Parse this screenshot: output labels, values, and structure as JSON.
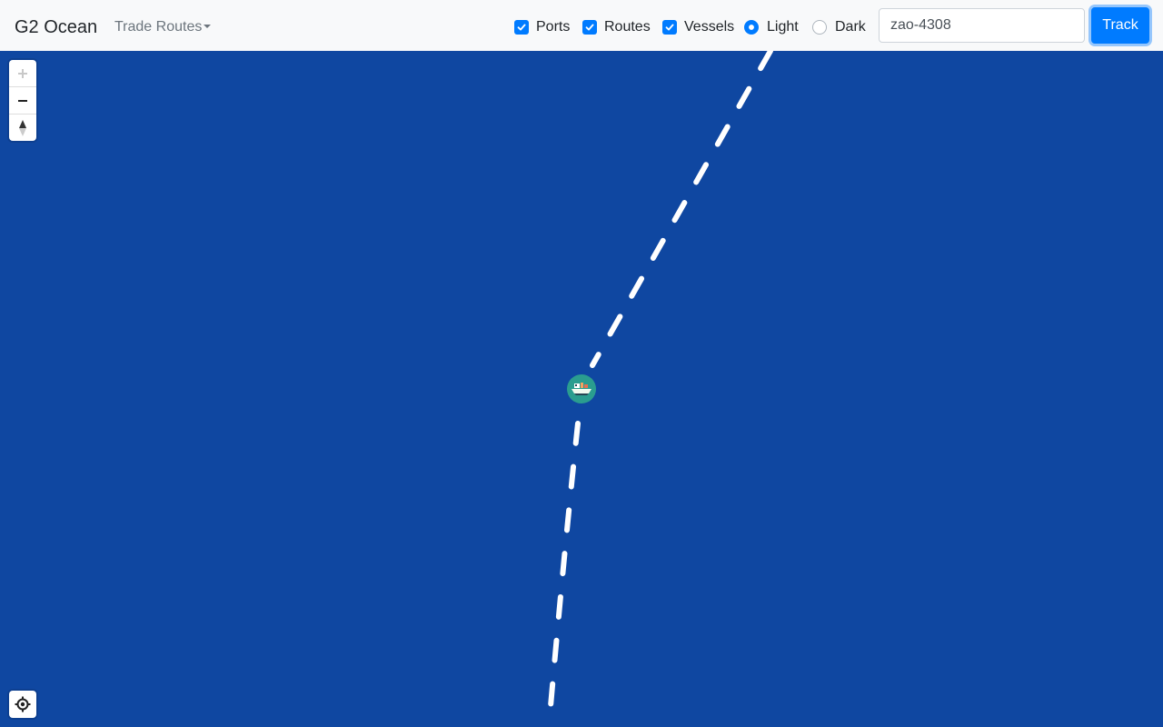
{
  "navbar": {
    "brand": "G2 Ocean",
    "dropdown_label": "Trade Routes",
    "layers": [
      {
        "label": "Ports",
        "checked": true
      },
      {
        "label": "Routes",
        "checked": true
      },
      {
        "label": "Vessels",
        "checked": true
      }
    ],
    "theme": [
      {
        "label": "Light",
        "selected": true
      },
      {
        "label": "Dark",
        "selected": false
      }
    ],
    "search_value": "zao-4308",
    "track_label": "Track"
  },
  "map": {
    "water_color": "#0f47a1",
    "route_color": "#ffffff",
    "accent_color": "#007bff",
    "controls": [
      "zoom-in-icon",
      "zoom-out-icon",
      "compass-icon",
      "locate-icon"
    ],
    "vessel_marker": "ship-icon"
  }
}
